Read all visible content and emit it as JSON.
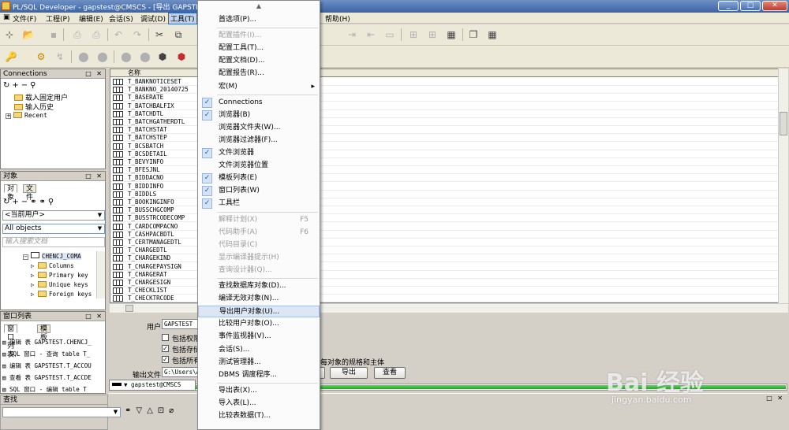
{
  "window": {
    "title": "PL/SQL Developer - gapstest@CMSCS - [导出 GAPSTEST",
    "minimize": "_",
    "maximize": "□",
    "close": "✕"
  },
  "menubar": {
    "items": [
      "文件(F)",
      "工程(P)",
      "编辑(E)",
      "会话(S)",
      "调试(D)",
      "工具(T)"
    ],
    "help": "帮助(H)"
  },
  "connections_panel": {
    "title": "Connections",
    "controls": "□ ✕",
    "items": [
      "载入固定用户",
      "输入历史",
      "Recent"
    ]
  },
  "objects_panel": {
    "title": "对象",
    "tabs": [
      "对象",
      "文件"
    ],
    "user_combo": "<当前用户>",
    "filter_combo": "All objects",
    "search_placeholder": "输入搜索文档",
    "tree": {
      "root": "CHENCJ_COMA",
      "children": [
        "Columns",
        "Primary key",
        "Unique keys",
        "Foreign keys"
      ]
    }
  },
  "window_list": {
    "title": "窗口列表",
    "tabs": [
      "窗口列表",
      "模板"
    ],
    "items": [
      "编辑 表 GAPSTEST.CHENCJ_",
      "SQL 窗口 - 查询 table T_",
      "编辑 表 GAPSTEST.T_ACCOU",
      "查看 表 GAPSTEST.T_ACCDE",
      "SQL 窗口 - 编辑 table T"
    ]
  },
  "find_bar": {
    "title": "查找"
  },
  "table_list": {
    "header": "名称",
    "rows": [
      "T_BANKNOTICESET",
      "T_BANKNO_20140725",
      "T_BASERATE",
      "T_BATCHBALFIX",
      "T_BATCHDTL",
      "T_BATCHGATHERDTL",
      "T_BATCHSTAT",
      "T_BATCHSTEP",
      "T_BCSBATCH",
      "T_BCSDETAIL",
      "T_BEVYINFO",
      "T_BFESJNL",
      "T_BIDDACNO",
      "T_BIDDINFO",
      "T_BIDDLS",
      "T_BOOKINGINFO",
      "T_BUSSCHGCOMP",
      "T_BUSSTRCODECOMP",
      "T_CARDCOMPACNO",
      "T_CASHPACBDTL",
      "T_CERTMANAGEDTL",
      "T_CHARGEDTL",
      "T_CHARGEKIND",
      "T_CHARGEPAYSIGN",
      "T_CHARGERAT",
      "T_CHARGESIGN",
      "T_CHECKLIST",
      "T_CHECKTRCODE"
    ]
  },
  "export_dialog": {
    "user_label": "用户",
    "user_value": "GAPSTEST",
    "checkboxes": [
      "包括权限",
      "包括存储",
      "包括所有"
    ],
    "output_label": "输出文件",
    "output_value": "G:\\Users\\A",
    "hint_text": "每对象的规格和主体",
    "export_button": "导出",
    "view_button": "查看",
    "progress": 1.0,
    "connection": "gapstest@CMSCS"
  },
  "tools_menu": {
    "items": [
      {
        "label": "首选项(P)...",
        "checked": false,
        "disabled": false
      },
      {
        "label": "配置插件(I)...",
        "checked": false,
        "disabled": true
      },
      {
        "label": "配置工具(T)...",
        "checked": false,
        "disabled": false
      },
      {
        "label": "配置文档(D)...",
        "checked": false,
        "disabled": false
      },
      {
        "label": "配置报告(R)...",
        "checked": false,
        "disabled": false
      },
      {
        "label": "宏(M)",
        "checked": false,
        "disabled": false,
        "submenu": true
      },
      {
        "label": "Connections",
        "checked": true,
        "disabled": false
      },
      {
        "label": "浏览器(B)",
        "checked": true,
        "disabled": false
      },
      {
        "label": "浏览器文件夹(W)...",
        "checked": false,
        "disabled": false
      },
      {
        "label": "浏览器过滤器(F)...",
        "checked": false,
        "disabled": false
      },
      {
        "label": "文件浏览器",
        "checked": true,
        "disabled": false
      },
      {
        "label": "文件浏览器位置",
        "checked": false,
        "disabled": false
      },
      {
        "label": "模板列表(E)",
        "checked": true,
        "disabled": false
      },
      {
        "label": "窗口列表(W)",
        "checked": true,
        "disabled": false
      },
      {
        "label": "工具栏",
        "checked": true,
        "disabled": false
      },
      {
        "label": "解释计划(X)",
        "shortcut": "F5",
        "checked": false,
        "disabled": true
      },
      {
        "label": "代码助手(A)",
        "shortcut": "F6",
        "checked": false,
        "disabled": true
      },
      {
        "label": "代码目录(C)",
        "checked": false,
        "disabled": true
      },
      {
        "label": "显示编译器提示(H)",
        "checked": false,
        "disabled": true
      },
      {
        "label": "查询设计器(Q)...",
        "checked": false,
        "disabled": true
      },
      {
        "label": "查找数据库对象(D)...",
        "checked": false,
        "disabled": false
      },
      {
        "label": "编译无效对象(N)...",
        "checked": false,
        "disabled": false
      },
      {
        "label": "导出用户对象(U)...",
        "checked": false,
        "disabled": false,
        "highlighted": true
      },
      {
        "label": "比较用户对象(O)...",
        "checked": false,
        "disabled": false
      },
      {
        "label": "事件监视器(V)...",
        "checked": false,
        "disabled": false
      },
      {
        "label": "会话(S)...",
        "checked": false,
        "disabled": false
      },
      {
        "label": "测试管理器...",
        "checked": false,
        "disabled": false
      },
      {
        "label": "DBMS 调度程序...",
        "checked": false,
        "disabled": false
      },
      {
        "label": "导出表(X)...",
        "checked": false,
        "disabled": false
      },
      {
        "label": "导入表(L)...",
        "checked": false,
        "disabled": false
      },
      {
        "label": "比较表数据(T)...",
        "checked": false,
        "disabled": false
      }
    ]
  },
  "watermark": {
    "brand": "Bai 经验",
    "url": "jingyan.baidu.com"
  }
}
